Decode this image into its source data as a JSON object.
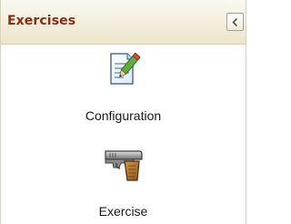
{
  "panel": {
    "title": "Exercises",
    "collapse_button_icon": "chevron-left-icon"
  },
  "items": [
    {
      "label": "Configuration",
      "icon": "document-edit-icon"
    },
    {
      "label": "Exercise",
      "icon": "pistol-icon"
    }
  ],
  "colors": {
    "title": "#8c2d12",
    "header_background": "#f2eedd",
    "border": "#d8d2bd"
  }
}
